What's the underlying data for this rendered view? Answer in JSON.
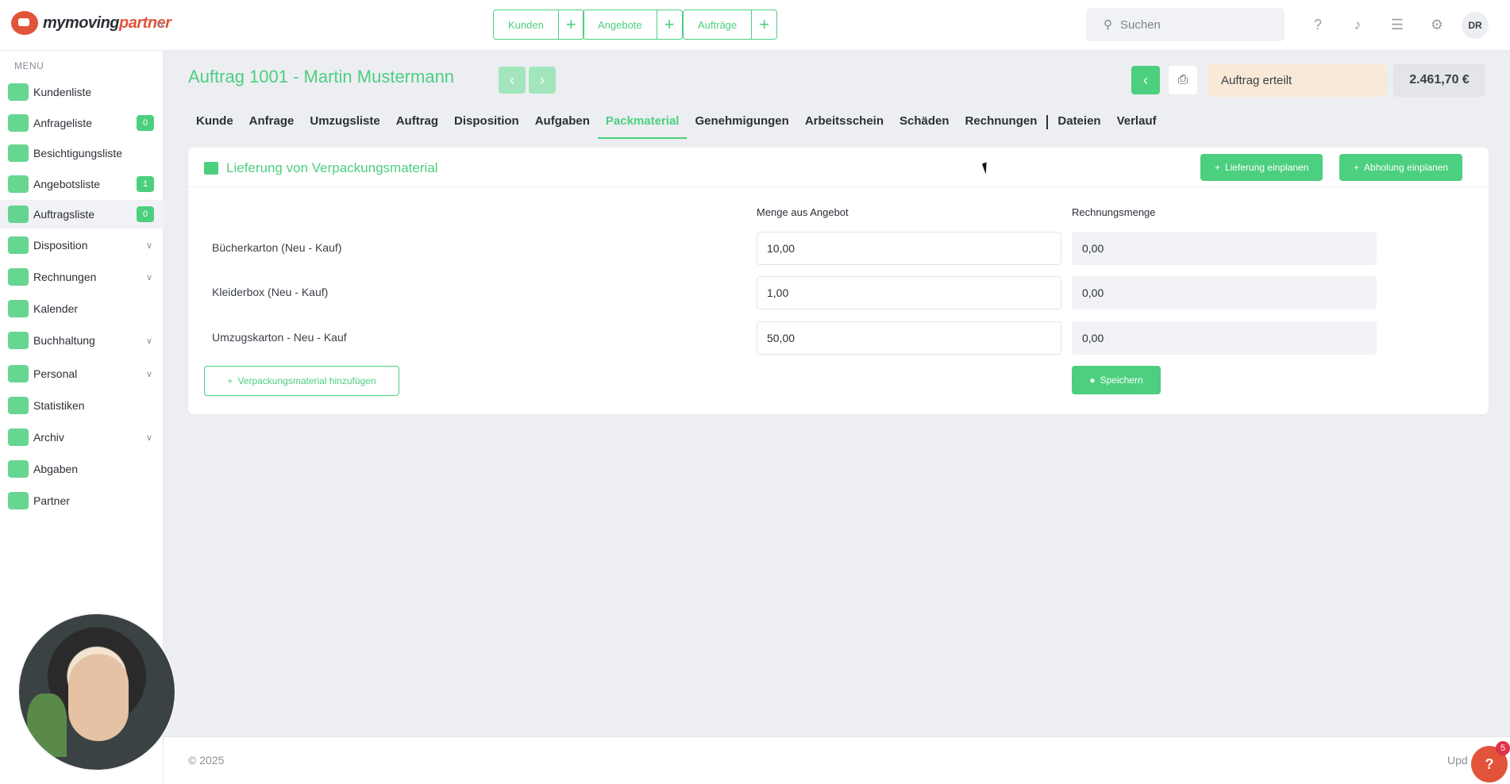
{
  "brand": {
    "logo_text_main": "mymoving",
    "logo_text_accent": "partner"
  },
  "topbar": {
    "quick_actions": [
      {
        "label": "Kunden"
      },
      {
        "label": "Angebote"
      },
      {
        "label": "Aufträge"
      }
    ],
    "search_placeholder": "Suchen",
    "user_initials": "DR"
  },
  "sidebar": {
    "menu_heading": "MENU",
    "items": [
      {
        "label": "Kundenliste",
        "badge": ""
      },
      {
        "label": "Anfrageliste",
        "badge": "0"
      },
      {
        "label": "Besichtigungsliste",
        "badge": ""
      },
      {
        "label": "Angebotsliste",
        "badge": "1"
      },
      {
        "label": "Auftragsliste",
        "badge": "0"
      },
      {
        "label": "Disposition",
        "badge": ""
      },
      {
        "label": "Rechnungen",
        "badge": ""
      },
      {
        "label": "Kalender",
        "badge": ""
      },
      {
        "label": "Buchhaltung",
        "badge": ""
      },
      {
        "label": "Personal",
        "badge": ""
      },
      {
        "label": "Statistiken",
        "badge": ""
      },
      {
        "label": "Archiv",
        "badge": ""
      },
      {
        "label": "Abgaben",
        "badge": ""
      },
      {
        "label": "Partner",
        "badge": ""
      }
    ]
  },
  "header": {
    "title": "Auftrag 1001 - Martin Mustermann",
    "status": "Auftrag erteilt",
    "price": "2.461,70 €"
  },
  "tabs": [
    "Kunde",
    "Anfrage",
    "Umzugsliste",
    "Auftrag",
    "Disposition",
    "Aufgaben",
    "Packmaterial",
    "Genehmigungen",
    "Arbeitsschein",
    "Schäden",
    "Rechnungen",
    "Dateien",
    "Verlauf"
  ],
  "active_tab": "Packmaterial",
  "card": {
    "title": "Lieferung von Verpackungsmaterial",
    "btn_delivery": "Lieferung einplanen",
    "btn_pickup": "Abholung einplanen",
    "col_offer": "Menge aus Angebot",
    "col_invoice": "Rechnungsmenge",
    "rows": [
      {
        "label": "Bücherkarton (Neu - Kauf)",
        "offer_qty": "10,00",
        "invoice_qty": "0,00"
      },
      {
        "label": "Kleiderbox (Neu - Kauf)",
        "offer_qty": "1,00",
        "invoice_qty": "0,00"
      },
      {
        "label": "Umzugskarton - Neu - Kauf",
        "offer_qty": "50,00",
        "invoice_qty": "0,00"
      }
    ],
    "btn_add": "Verpackungsmaterial hinzufügen",
    "btn_save": "Speichern"
  },
  "footer": {
    "copyright": "© 2025",
    "update_text": "Upd"
  },
  "help": {
    "label": "?",
    "badge": "5"
  },
  "colors": {
    "accent": "#4ccf7e",
    "brand": "#e2543a",
    "status_bg": "#f9ead8"
  }
}
